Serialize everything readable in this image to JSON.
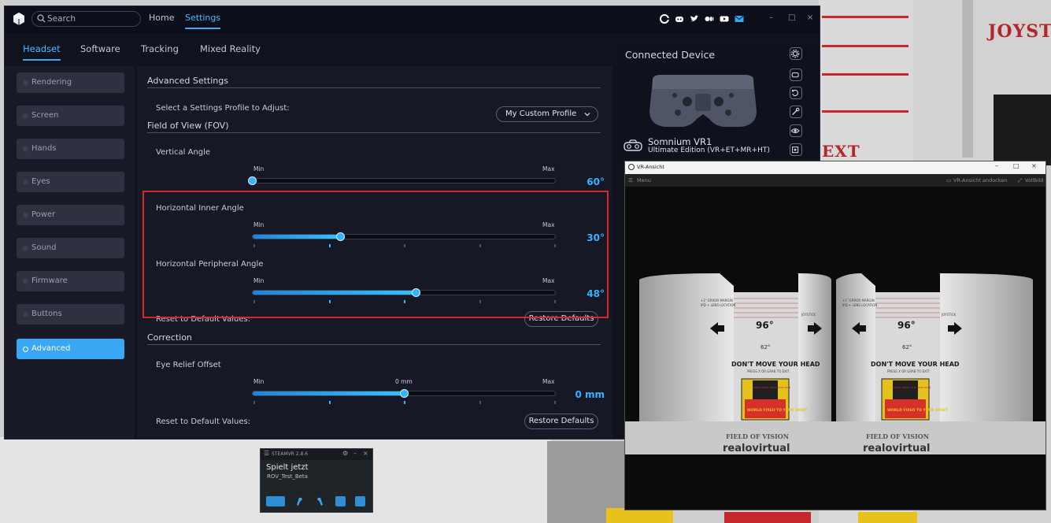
{
  "colors": {
    "accent": "#3aa7f5",
    "highlight": "#d92828",
    "value": "#38b2ff"
  },
  "background": {
    "text_top": "JOYSTIC",
    "text_mid": "EXT"
  },
  "app": {
    "search_placeholder": "Search",
    "top_nav": [
      {
        "label": "Home",
        "active": false
      },
      {
        "label": "Settings",
        "active": true
      }
    ],
    "social_icons": [
      "circle-logo-icon",
      "discord-icon",
      "twitter-icon",
      "medium-icon",
      "youtube-icon",
      "mail-icon"
    ],
    "window_controls": [
      "–",
      "□",
      "×"
    ],
    "tabs": [
      {
        "label": "Headset",
        "active": true
      },
      {
        "label": "Software",
        "active": false
      },
      {
        "label": "Tracking",
        "active": false
      },
      {
        "label": "Mixed Reality",
        "active": false
      }
    ],
    "sidebar": [
      {
        "label": "Rendering",
        "active": false
      },
      {
        "label": "Screen",
        "active": false
      },
      {
        "label": "Hands",
        "active": false
      },
      {
        "label": "Eyes",
        "active": false
      },
      {
        "label": "Power",
        "active": false
      },
      {
        "label": "Sound",
        "active": false
      },
      {
        "label": "Firmware",
        "active": false
      },
      {
        "label": "Buttons",
        "active": false
      },
      {
        "label": "Advanced",
        "active": true
      }
    ],
    "main": {
      "advanced_title": "Advanced Settings",
      "profile_label": "Select a Settings Profile to Adjust:",
      "profile_value": "My Custom Profile",
      "fov_title": "Field of View (FOV)",
      "min_label": "Min",
      "max_label": "Max",
      "vertical": {
        "label": "Vertical Angle",
        "value": "60°",
        "level": 0.0
      },
      "inner": {
        "label": "Horizontal Inner Angle",
        "value": "30°",
        "level": 0.29
      },
      "peripheral": {
        "label": "Horizontal Peripheral Angle",
        "value": "48°",
        "level": 0.54
      },
      "reset_label": "Reset to Default Values:",
      "restore_button": "Restore Defaults",
      "correction_title": "Correction",
      "eye_relief": {
        "label": "Eye Relief Offset",
        "value": "0 mm",
        "mid_label": "0 mm",
        "level": 0.5
      },
      "reset_label_2": "Reset to Default Values:",
      "restore_button_2": "Restore Defaults"
    },
    "device": {
      "title": "Connected Device",
      "name": "Somnium VR1",
      "edition": "Ultimate Edition (VR+ET+MR+HT)",
      "icons": [
        "settings-icon",
        "headset-view-icon",
        "reset-icon",
        "tools-icon",
        "eye-icon",
        "tracking-icon"
      ]
    }
  },
  "vr_window": {
    "title": "VR-Ansicht",
    "menu": "Menu",
    "dock": "VR-Ansicht andocken",
    "fullscreen": "Vollbild",
    "scene": {
      "fov_big": "96°",
      "fov_small": "62°",
      "warning": "DON'T MOVE YOUR HEAD",
      "press_text": "PRESS X OR GRAB TO EXIT",
      "sign_text": "DON'T MOVE YOUR HEAD HERE",
      "sign_footer": "WORLD FIXED TO YOUR SIGHT",
      "brand_top": "FIELD OF VISION",
      "brand": "realovirtual",
      "side_label": "JOYSTICK",
      "margin_label": "+1° ERROR MARGIN",
      "margin_sub": "IPD + LENS LOCATION"
    }
  },
  "steamvr": {
    "title": "STEAMVR 2.8.6",
    "playing": "Spielt jetzt",
    "game": "ROV_Test_Beta",
    "icons": [
      "headset-status-icon",
      "controller-left-icon",
      "controller-right-icon",
      "tracker-icon",
      "tracker-icon"
    ]
  }
}
